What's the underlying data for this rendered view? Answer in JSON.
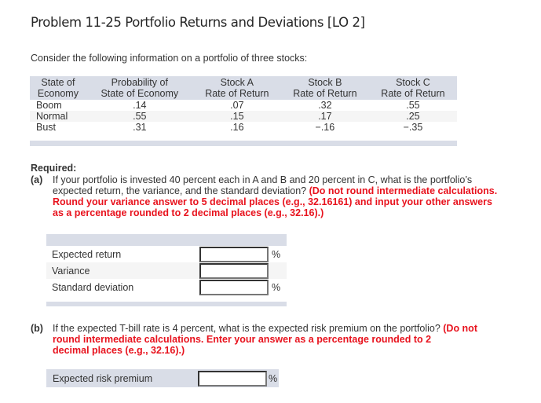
{
  "title": "Problem 11-25 Portfolio Returns and Deviations [LO 2]",
  "intro": "Consider the following information on a portfolio of three stocks:",
  "table": {
    "headers": [
      [
        "State of",
        "Economy"
      ],
      [
        "Probability of",
        "State of Economy"
      ],
      [
        "Stock A",
        "Rate of Return"
      ],
      [
        "Stock B",
        "Rate of Return"
      ],
      [
        "Stock C",
        "Rate of Return"
      ]
    ],
    "rows": [
      [
        "Boom",
        ".14",
        ".07",
        ".32",
        ".55"
      ],
      [
        "Normal",
        ".55",
        ".15",
        ".17",
        ".25"
      ],
      [
        "Bust",
        ".31",
        ".16",
        "−.16",
        "−.35"
      ]
    ]
  },
  "required_label": "Required:",
  "part_a": {
    "label": "(a)",
    "text_line1": "If your portfolio is invested 40 percent each in A and B and 20 percent in C, what is the portfolio’s",
    "text_line2_plain": "expected return, the variance, and the standard deviation? ",
    "text_line2_red": "(Do not round intermediate calculations.",
    "red_line3": "Round your variance answer to 5 decimal places (e.g., 32.16161) and input your other answers",
    "red_line4": "as a percentage rounded to 2 decimal places (e.g., 32.16).)",
    "answers": [
      {
        "label": "Expected return",
        "value": "",
        "unit": "%"
      },
      {
        "label": "Variance",
        "value": "",
        "unit": ""
      },
      {
        "label": "Standard deviation",
        "value": "",
        "unit": "%"
      }
    ]
  },
  "part_b": {
    "label": "(b)",
    "text_line1_plain": "If the expected T-bill rate is 4 percent, what is the expected risk premium on the portfolio? ",
    "text_line1_red": "(Do not",
    "red_line2": "round intermediate calculations. Enter your answer as a percentage rounded to 2",
    "red_line3": "decimal places (e.g., 32.16).)",
    "answer": {
      "label": "Expected risk premium",
      "value": "",
      "unit": "%"
    }
  }
}
